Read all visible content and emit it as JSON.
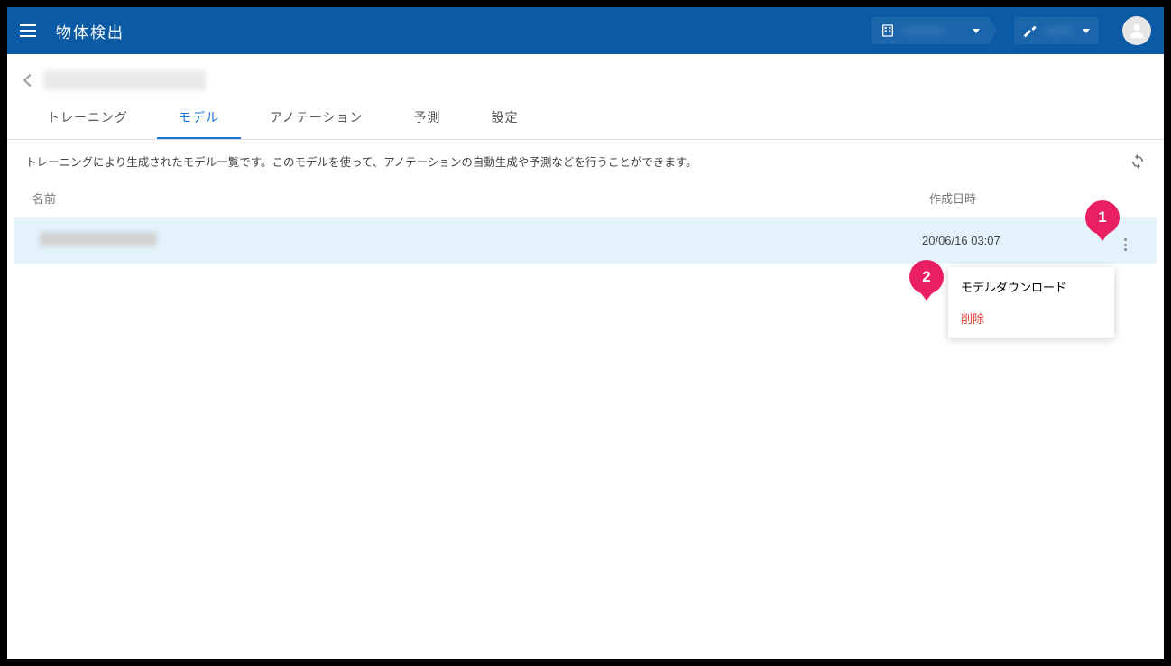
{
  "header": {
    "app_title": "物体検出"
  },
  "tabs": {
    "training": "トレーニング",
    "model": "モデル",
    "annotation": "アノテーション",
    "prediction": "予測",
    "settings": "設定"
  },
  "description": "トレーニングにより生成されたモデル一覧です。このモデルを使って、アノテーションの自動生成や予測などを行うことができます。",
  "table": {
    "col_name": "名前",
    "col_date": "作成日時",
    "rows": [
      {
        "date": "20/06/16 03:07"
      }
    ]
  },
  "menu": {
    "download": "モデルダウンロード",
    "delete": "削除"
  },
  "annotations": {
    "a1": "1",
    "a2": "2"
  }
}
